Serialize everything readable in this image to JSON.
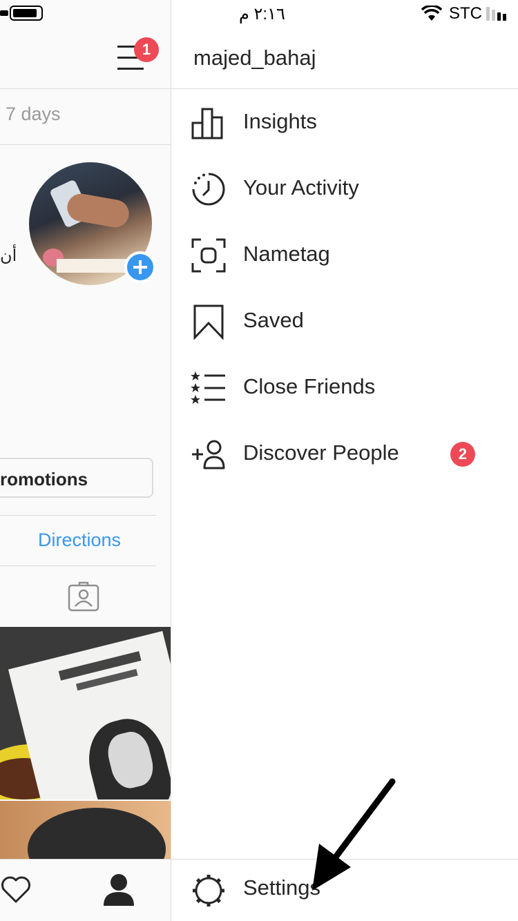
{
  "status_bar": {
    "time": "٢:١٦ م",
    "carrier": "STC"
  },
  "left_panel": {
    "menu_badge": "1",
    "days_text": "7 days",
    "side_text": "أن",
    "promotions_label": "romotions",
    "directions_label": "Directions"
  },
  "drawer": {
    "username": "majed_bahaj",
    "items": [
      {
        "label": "Insights",
        "icon": "insights-icon"
      },
      {
        "label": "Your Activity",
        "icon": "activity-icon"
      },
      {
        "label": "Nametag",
        "icon": "nametag-icon"
      },
      {
        "label": "Saved",
        "icon": "bookmark-icon"
      },
      {
        "label": "Close Friends",
        "icon": "close-friends-icon"
      },
      {
        "label": "Discover People",
        "icon": "add-person-icon",
        "badge": "2"
      }
    ],
    "settings_label": "Settings"
  },
  "colors": {
    "badge": "#ed4956",
    "link": "#3897f0",
    "divider": "#dbdbdb",
    "add_story": "#3897f0"
  }
}
